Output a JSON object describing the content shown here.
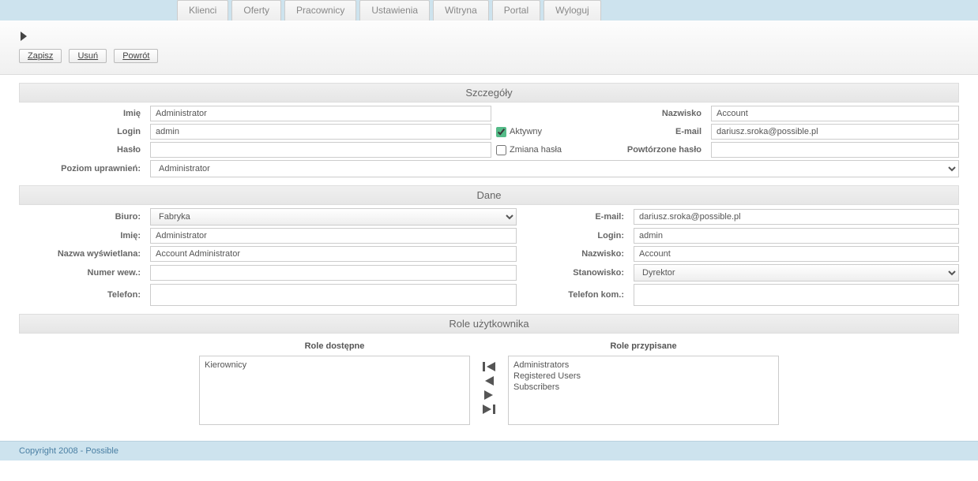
{
  "nav": [
    "Klienci",
    "Oferty",
    "Pracownicy",
    "Ustawienia",
    "Witryna",
    "Portal",
    "Wyloguj"
  ],
  "actions": {
    "save": "Zapisz",
    "delete": "Usuń",
    "back": "Powrót"
  },
  "sections": {
    "details": "Szczegóły",
    "data": "Dane",
    "roles": "Role użytkownika"
  },
  "details": {
    "labels": {
      "imie": "Imię",
      "nazwisko": "Nazwisko",
      "login": "Login",
      "email": "E-mail",
      "haslo": "Hasło",
      "powt_haslo": "Powtórzone hasło",
      "poziom": "Poziom uprawnień:",
      "aktywny": "Aktywny",
      "zmiana": "Zmiana hasła"
    },
    "values": {
      "imie": "Administrator",
      "nazwisko": "Account",
      "login": "admin",
      "email": "dariusz.sroka@possible.pl",
      "haslo": "",
      "powt_haslo": "",
      "aktywny": true,
      "zmiana": false,
      "poziom": "Administrator"
    }
  },
  "dane": {
    "labels": {
      "biuro": "Biuro:",
      "email": "E-mail:",
      "imie": "Imię:",
      "login": "Login:",
      "nazwa_wysw": "Nazwa wyświetlana:",
      "nazwisko": "Nazwisko:",
      "numer_wew": "Numer wew.:",
      "stanowisko": "Stanowisko:",
      "telefon": "Telefon:",
      "telefon_kom": "Telefon kom.:"
    },
    "values": {
      "biuro": "Fabryka",
      "email": "dariusz.sroka@possible.pl",
      "imie": "Administrator",
      "login": "admin",
      "nazwa_wysw": "Account Administrator",
      "nazwisko": "Account",
      "numer_wew": "",
      "stanowisko": "Dyrektor",
      "telefon": "",
      "telefon_kom": ""
    }
  },
  "roles": {
    "available_label": "Role dostępne",
    "assigned_label": "Role przypisane",
    "available": [
      "Kierownicy"
    ],
    "assigned": [
      "Administrators",
      "Registered Users",
      "Subscribers"
    ]
  },
  "footer": "Copyright 2008 - Possible"
}
